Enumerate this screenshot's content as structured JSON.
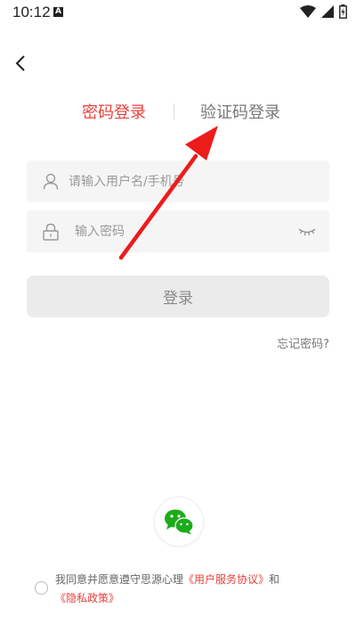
{
  "status_bar": {
    "time": "10:12",
    "notification_letter": "A"
  },
  "tabs": {
    "password_login": "密码登录",
    "sms_login": "验证码登录"
  },
  "form": {
    "username_placeholder": "请输入用户名/手机号",
    "password_placeholder": "输入密码",
    "login_button": "登录",
    "forgot_password": "忘记密码?"
  },
  "agreement": {
    "prefix": "我同意并愿意遵守思源心理",
    "user_agreement": "《用户服务协议》",
    "conjunction": "和",
    "privacy_policy": "《隐私政策》"
  },
  "colors": {
    "accent": "#e8413c",
    "wechat": "#1aad19",
    "arrow": "#ee1b1b"
  },
  "icons": {
    "back": "chevron-left-icon",
    "user": "user-icon",
    "lock": "lock-icon",
    "eye": "eye-closed-icon",
    "wechat": "wechat-icon"
  }
}
